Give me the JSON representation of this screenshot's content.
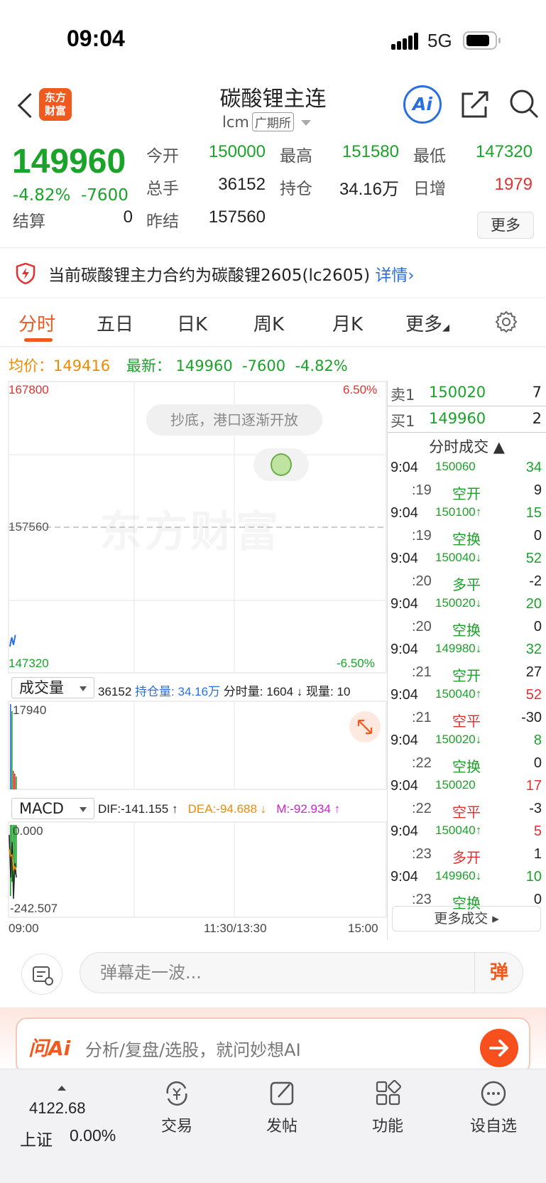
{
  "status": {
    "time": "09:04",
    "network": "5G"
  },
  "header": {
    "logo_line1": "东方",
    "logo_line2": "财富",
    "title": "碳酸锂主连",
    "code": "lcm",
    "exchange": "广期所",
    "ai_label": "Ai"
  },
  "quote": {
    "price": "149960",
    "change_pct": "-4.82%",
    "change": "-7600",
    "open_label": "今开",
    "open": "150000",
    "high_label": "最高",
    "high": "151580",
    "low_label": "最低",
    "low": "147320",
    "volume_label": "总手",
    "volume": "36152",
    "oi_label": "持仓",
    "oi": "34.16万",
    "daily_inc_label": "日增",
    "daily_inc": "1979",
    "settle_label": "结算",
    "settle": "0",
    "prev_settle_label": "昨结",
    "prev_settle": "157560",
    "more_label": "更多"
  },
  "notice": {
    "text": "当前碳酸锂主力合约为碳酸锂2605(lc2605)",
    "link": "详情"
  },
  "tabs": [
    "分时",
    "五日",
    "日K",
    "周K",
    "月K",
    "更多"
  ],
  "summary": {
    "avg_label": "均价：",
    "avg": "149416",
    "latest_label": "最新：",
    "latest": "149960",
    "change": "-7600",
    "change_pct": "-4.82%"
  },
  "chart": {
    "y_max": "167800",
    "y_mid": "157560",
    "y_min": "147320",
    "pct_max": "6.50%",
    "pct_min": "-6.50%",
    "bubble_text": "抄底，港口逐渐开放",
    "watermark": "东方财富",
    "x_start": "09:00",
    "x_mid": "11:30/13:30",
    "x_end": "15:00",
    "volume_select": "成交量",
    "volume_info": {
      "total": "36152",
      "oi_label": "持仓量:",
      "oi": "34.16万",
      "min_vol_label": "分时量:",
      "min_vol": "1604 ↓",
      "now_label": "现量:",
      "now": "10"
    },
    "volume_max": "17940",
    "macd_select": "MACD",
    "dif": "DIF:-141.155 ↑",
    "dea": "DEA:-94.688 ↓",
    "m": "M:-92.934 ↑",
    "macd_max": "0.000",
    "macd_min": "-242.507",
    "chart_data": {
      "type": "line",
      "x": [
        "09:01",
        "09:02",
        "09:03",
        "09:04"
      ],
      "series": [
        {
          "values": [
            149200,
            149800,
            149300,
            149960
          ]
        }
      ],
      "ylim": [
        147320,
        167800
      ]
    },
    "colors": {
      "up": "#e63030",
      "down": "#1aa329",
      "avg": "#f08a00",
      "price": "#2a6fe0"
    }
  },
  "orderbook": {
    "sell_label": "卖1",
    "sell_price": "150020",
    "sell_vol": "7",
    "buy_label": "买1",
    "buy_price": "149960",
    "buy_vol": "2"
  },
  "ticks": {
    "title": "分时成交 ▲",
    "rows": [
      {
        "time": "9:04",
        "price": "150060",
        "arrow": "",
        "vol": "34",
        "sec": ":19",
        "type": "空开",
        "diff": "9",
        "pc": "green",
        "vc": "green",
        "tc": "green"
      },
      {
        "time": "9:04",
        "price": "150100↑",
        "arrow": "",
        "vol": "15",
        "sec": ":19",
        "type": "空换",
        "diff": "0",
        "pc": "green",
        "vc": "green",
        "tc": "green"
      },
      {
        "time": "9:04",
        "price": "150040↓",
        "arrow": "",
        "vol": "52",
        "sec": ":20",
        "type": "多平",
        "diff": "-2",
        "pc": "green",
        "vc": "green",
        "tc": "green"
      },
      {
        "time": "9:04",
        "price": "150020↓",
        "arrow": "",
        "vol": "20",
        "sec": ":20",
        "type": "空换",
        "diff": "0",
        "pc": "green",
        "vc": "green",
        "tc": "green"
      },
      {
        "time": "9:04",
        "price": "149980↓",
        "arrow": "",
        "vol": "32",
        "sec": ":21",
        "type": "空开",
        "diff": "27",
        "pc": "green",
        "vc": "green",
        "tc": "green"
      },
      {
        "time": "9:04",
        "price": "150040↑",
        "arrow": "",
        "vol": "52",
        "sec": ":21",
        "type": "空平",
        "diff": "-30",
        "pc": "green",
        "vc": "red",
        "tc": "red"
      },
      {
        "time": "9:04",
        "price": "150020↓",
        "arrow": "",
        "vol": "8",
        "sec": ":22",
        "type": "空换",
        "diff": "0",
        "pc": "green",
        "vc": "green",
        "tc": "green"
      },
      {
        "time": "9:04",
        "price": "150020",
        "arrow": "",
        "vol": "17",
        "sec": ":22",
        "type": "空平",
        "diff": "-3",
        "pc": "green",
        "vc": "red",
        "tc": "red"
      },
      {
        "time": "9:04",
        "price": "150040↑",
        "arrow": "",
        "vol": "5",
        "sec": ":23",
        "type": "多开",
        "diff": "1",
        "pc": "green",
        "vc": "red",
        "tc": "red"
      },
      {
        "time": "9:04",
        "price": "149960↓",
        "arrow": "",
        "vol": "10",
        "sec": ":23",
        "type": "空换",
        "diff": "0",
        "pc": "green",
        "vc": "green",
        "tc": "green"
      }
    ],
    "more_label": "更多成交 ▸"
  },
  "danmu": {
    "placeholder": "弹幕走一波...",
    "send": "弹"
  },
  "ai_bar": {
    "logo": "问Ai",
    "hint": "分析/复盘/选股，就问妙想AI"
  },
  "bottom_nav": {
    "index_value": "4122.68",
    "index_name": "上证",
    "index_change": "0.00%",
    "items": [
      "交易",
      "发帖",
      "功能",
      "设自选"
    ]
  }
}
